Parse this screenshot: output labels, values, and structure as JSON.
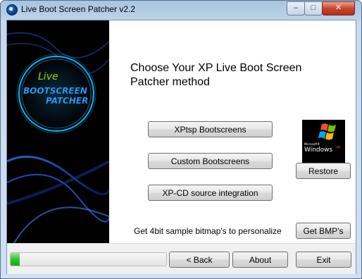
{
  "window": {
    "title": "Live Boot Screen Patcher v2.2",
    "controls": {
      "minimize": "–",
      "maximize": "□",
      "close": "✕"
    }
  },
  "sidebar": {
    "logo_line1": "Live",
    "logo_line2": "BOOTSCREEN",
    "logo_line3": "PATCHER"
  },
  "main": {
    "heading": "Choose Your XP Live Boot Screen Patcher method",
    "buttons": {
      "xptsp": "XPtsp Bootscreens",
      "custom": "Custom Bootscreens",
      "xpcd": "XP-CD source integration",
      "restore": "Restore",
      "get_bmps": "Get BMP's"
    },
    "sample_text": "Get 4bit sample bitmap's to personalize",
    "xp_logo": {
      "microsoft": "Microsoft®",
      "windows": "Windows",
      "xp": "xp"
    }
  },
  "footer": {
    "progress": 0.06,
    "back": "< Back",
    "about": "About",
    "exit": "Exit"
  },
  "colors": {
    "progress_green": "#2fc42f",
    "close_red": "#c7442b",
    "logo_green": "#9bd400",
    "logo_blue": "#2aa8ff"
  }
}
